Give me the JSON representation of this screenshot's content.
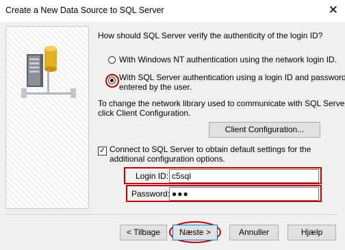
{
  "window": {
    "title": "Create a New Data Source to SQL Server",
    "close_glyph": "✕"
  },
  "question": "How should SQL Server verify the authenticity of the login ID?",
  "auth_options": [
    {
      "label": "With Windows NT authentication using the network login ID.",
      "selected": false
    },
    {
      "label_line1": "With SQL Server authentication using a login ID and password",
      "label_line2": "entered by the user.",
      "selected": true
    }
  ],
  "network_text": {
    "line1": "To change the network library used to communicate with SQL Server,",
    "line2": "click Client Configuration."
  },
  "client_config_button": "Client Configuration...",
  "connect_checkbox": {
    "checked": true,
    "glyph": "✓",
    "line1": "Connect to SQL Server to obtain default settings for the",
    "line2": "additional configuration options."
  },
  "login": {
    "label": "Login ID:",
    "value": "c5sql"
  },
  "password": {
    "label": "Password:",
    "masked_value": "●●●"
  },
  "buttons": {
    "back": "< Tilbage",
    "next": "Næste >",
    "cancel": "Annuller",
    "help": "Hjælp"
  },
  "icons": {
    "left_art": "server-database-icon"
  },
  "colors": {
    "highlight": "#c00000",
    "background": "#f0f0f0"
  }
}
